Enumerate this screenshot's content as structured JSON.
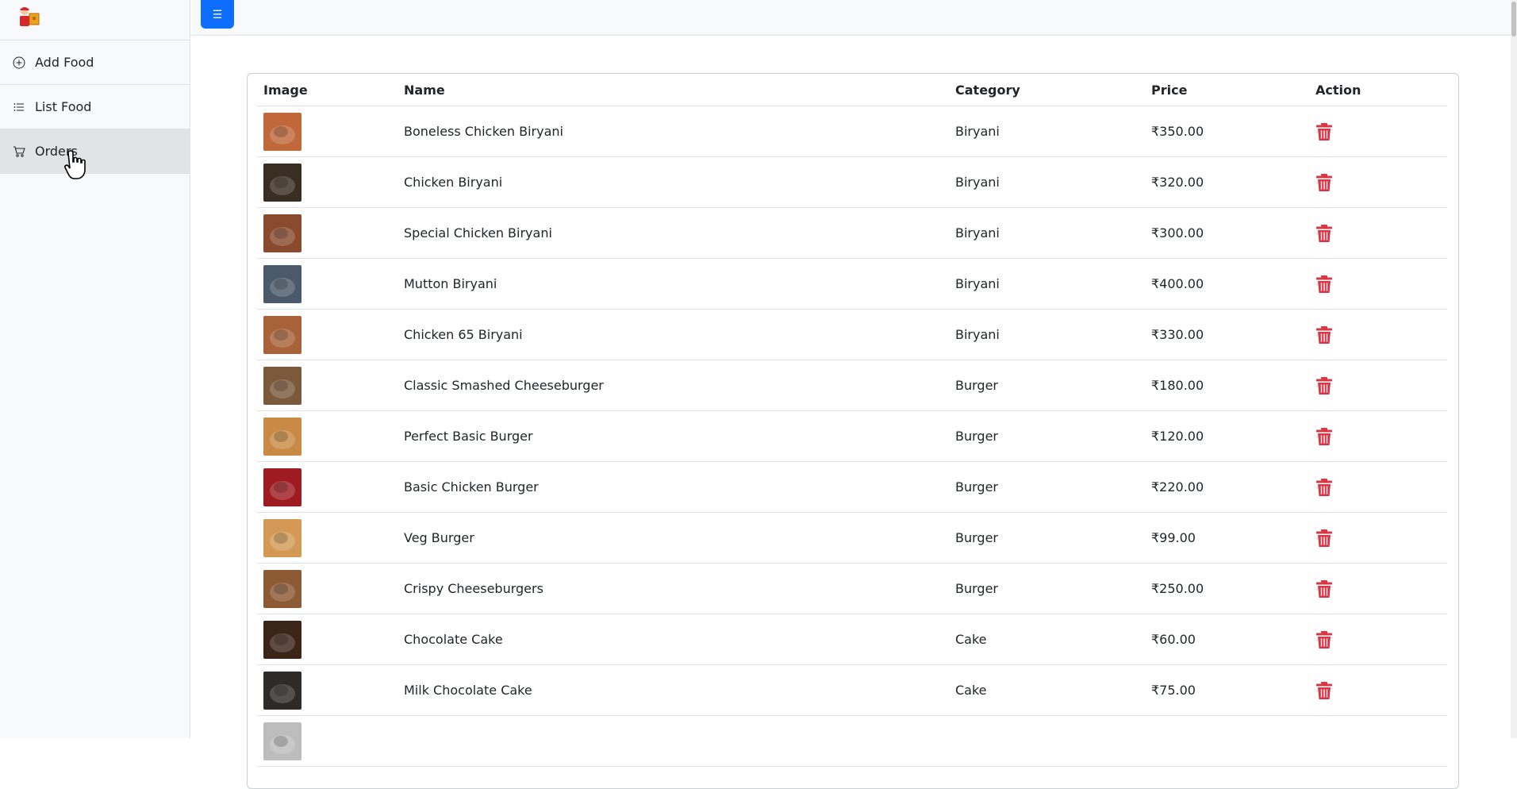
{
  "app": {
    "logo_icon": "delivery-person-logo"
  },
  "sidebar": {
    "items": [
      {
        "label": "Add Food",
        "icon": "plus-circle-icon"
      },
      {
        "label": "List Food",
        "icon": "list-icon"
      },
      {
        "label": "Orders",
        "icon": "cart-icon",
        "active": true
      }
    ]
  },
  "topbar": {
    "menu_icon": "☰"
  },
  "table": {
    "headers": {
      "image": "Image",
      "name": "Name",
      "category": "Category",
      "price": "Price",
      "action": "Action"
    },
    "rows": [
      {
        "name": "Boneless Chicken Biryani",
        "category": "Biryani",
        "price": "₹350.00",
        "thumb_color": "#c0683a"
      },
      {
        "name": "Chicken Biryani",
        "category": "Biryani",
        "price": "₹320.00",
        "thumb_color": "#3a2d22"
      },
      {
        "name": "Special Chicken Biryani",
        "category": "Biryani",
        "price": "₹300.00",
        "thumb_color": "#8a4a2e"
      },
      {
        "name": "Mutton Biryani",
        "category": "Biryani",
        "price": "₹400.00",
        "thumb_color": "#4a5a6a"
      },
      {
        "name": "Chicken 65 Biryani",
        "category": "Biryani",
        "price": "₹330.00",
        "thumb_color": "#a8623a"
      },
      {
        "name": "Classic Smashed Cheeseburger",
        "category": "Burger",
        "price": "₹180.00",
        "thumb_color": "#7b5a3c"
      },
      {
        "name": "Perfect Basic Burger",
        "category": "Burger",
        "price": "₹120.00",
        "thumb_color": "#c98a45"
      },
      {
        "name": "Basic Chicken Burger",
        "category": "Burger",
        "price": "₹220.00",
        "thumb_color": "#9e1b22"
      },
      {
        "name": "Veg Burger",
        "category": "Burger",
        "price": "₹99.00",
        "thumb_color": "#d49a55"
      },
      {
        "name": "Crispy Cheeseburgers",
        "category": "Burger",
        "price": "₹250.00",
        "thumb_color": "#8c5a35"
      },
      {
        "name": "Chocolate Cake",
        "category": "Cake",
        "price": "₹60.00",
        "thumb_color": "#3b2418"
      },
      {
        "name": "Milk Chocolate Cake",
        "category": "Cake",
        "price": "₹75.00",
        "thumb_color": "#2e2a28"
      },
      {
        "name": "",
        "category": "",
        "price": "",
        "thumb_color": "#bdbdbd"
      }
    ]
  },
  "colors": {
    "accent": "#0d6efd",
    "delete": "#dc3545"
  }
}
